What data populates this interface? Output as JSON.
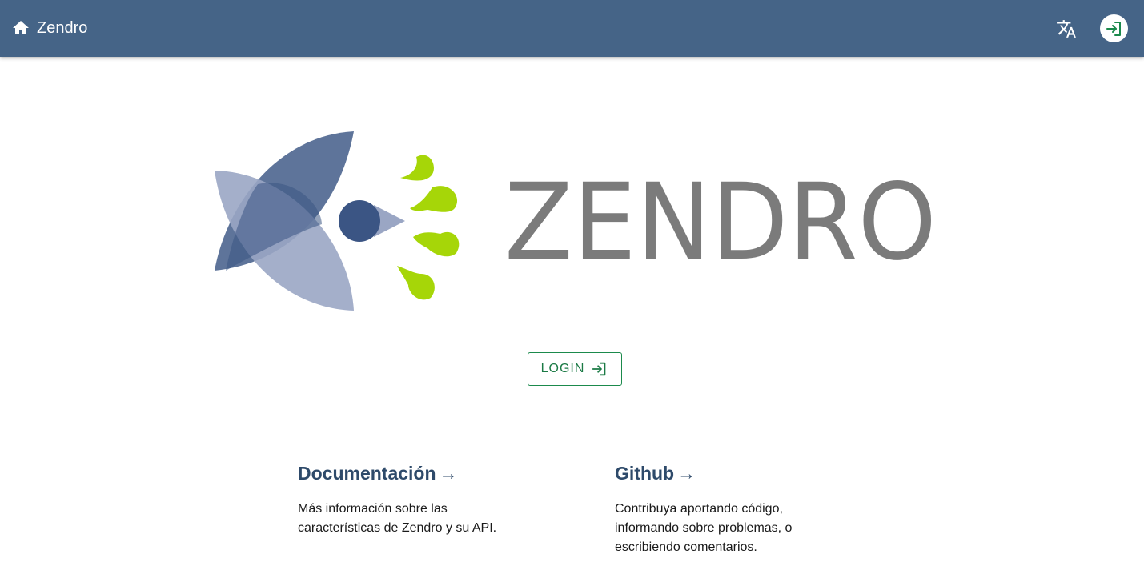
{
  "header": {
    "title": "Zendro",
    "home_icon": "home-icon",
    "translate_icon": "translate-icon",
    "login_icon": "login-icon",
    "background": "#456487"
  },
  "logo": {
    "wordmark": "ZENDRO",
    "colors": {
      "petals_dark": "#3b5584",
      "petals_light": "#9aa6c4",
      "drops": "#a6d608",
      "text": "#7b7b7b"
    }
  },
  "login_button": {
    "label": "LOGIN",
    "icon": "login-icon",
    "color": "#1b7a45"
  },
  "cards": {
    "docs": {
      "title": "Documentación",
      "arrow": "→",
      "text": "Más información sobre las características de Zendro y su API."
    },
    "github": {
      "title": "Github",
      "arrow": "→",
      "text": "Contribuya aportando código, informando sobre problemas, o escribiendo comentarios."
    }
  }
}
